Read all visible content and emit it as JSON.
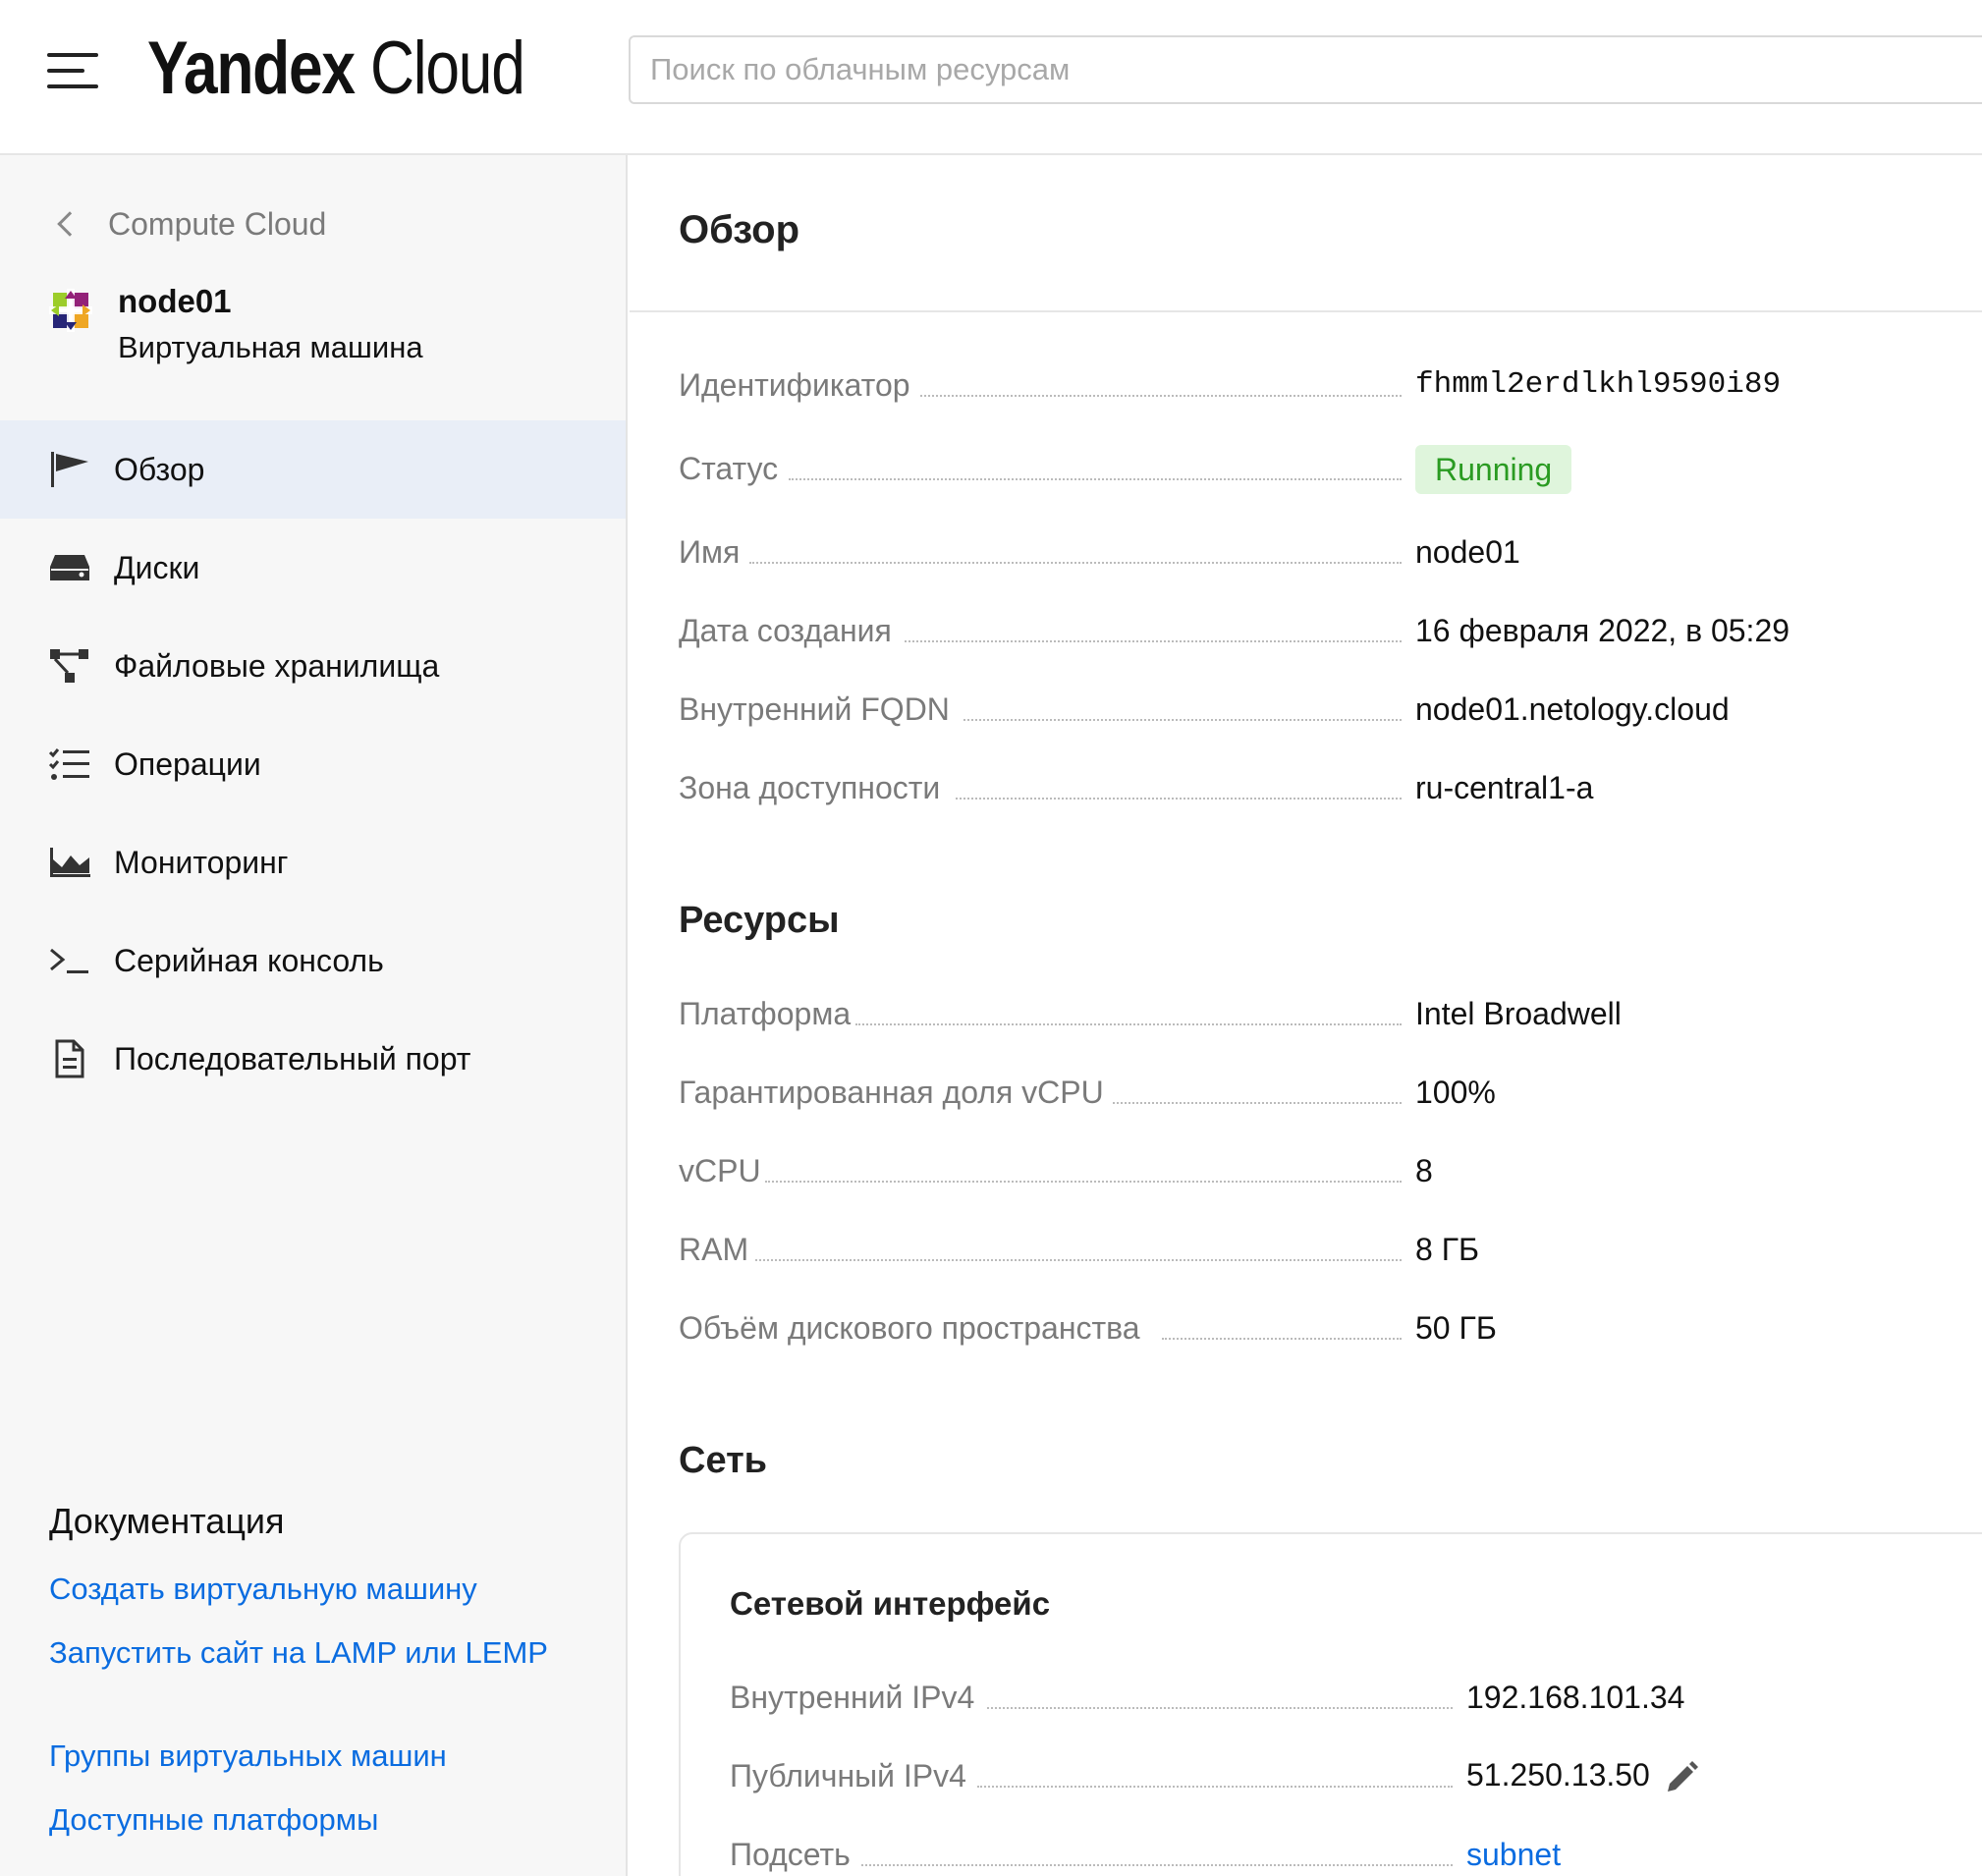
{
  "header": {
    "logo_bold": "Yandex",
    "logo_light": "Cloud",
    "search_placeholder": "Поиск по облачным ресурсам"
  },
  "sidebar": {
    "back_label": "Compute Cloud",
    "vm_name": "node01",
    "vm_type": "Виртуальная машина",
    "items": [
      {
        "label": "Обзор",
        "icon": "flag-icon",
        "active": true
      },
      {
        "label": "Диски",
        "icon": "disk-icon"
      },
      {
        "label": "Файловые хранилища",
        "icon": "file-storage-icon"
      },
      {
        "label": "Операции",
        "icon": "operations-list-icon"
      },
      {
        "label": "Мониторинг",
        "icon": "monitoring-chart-icon"
      },
      {
        "label": "Серийная консоль",
        "icon": "terminal-icon"
      },
      {
        "label": "Последовательный порт",
        "icon": "document-icon"
      }
    ],
    "docs_title": "Документация",
    "docs_links": [
      "Создать виртуальную машину",
      "Запустить сайт на LAMP или LEMP",
      "Группы виртуальных машин",
      "Доступные платформы"
    ]
  },
  "main": {
    "title": "Обзор",
    "overview": [
      {
        "key": "Идентификатор",
        "value": "fhmml2erdlkhl9590i89"
      },
      {
        "key": "Статус",
        "value": "Running"
      },
      {
        "key": "Имя",
        "value": "node01"
      },
      {
        "key": "Дата создания",
        "value": "16 февраля 2022, в 05:29"
      },
      {
        "key": "Внутренний FQDN",
        "value": "node01.netology.cloud"
      },
      {
        "key": "Зона доступности",
        "value": "ru-central1-a"
      }
    ],
    "resources_title": "Ресурсы",
    "resources": [
      {
        "key": "Платформа",
        "value": "Intel Broadwell"
      },
      {
        "key": "Гарантированная доля vCPU",
        "value": "100%"
      },
      {
        "key": "vCPU",
        "value": "8"
      },
      {
        "key": "RAM",
        "value": "8 ГБ"
      },
      {
        "key": "Объём дискового пространства",
        "value": "50 ГБ"
      }
    ],
    "network_title": "Сеть",
    "network_card": {
      "title": "Сетевой интерфейс",
      "rows": [
        {
          "key": "Внутренний IPv4",
          "value": "192.168.101.34"
        },
        {
          "key": "Публичный IPv4",
          "value": "51.250.13.50"
        },
        {
          "key": "Подсеть",
          "value": "subnet"
        }
      ]
    }
  },
  "colors": {
    "accent_link": "#0a6ce0",
    "status_bg": "#dff5dc",
    "status_text": "#2a9b22",
    "nav_active_bg": "#e9eef7"
  }
}
